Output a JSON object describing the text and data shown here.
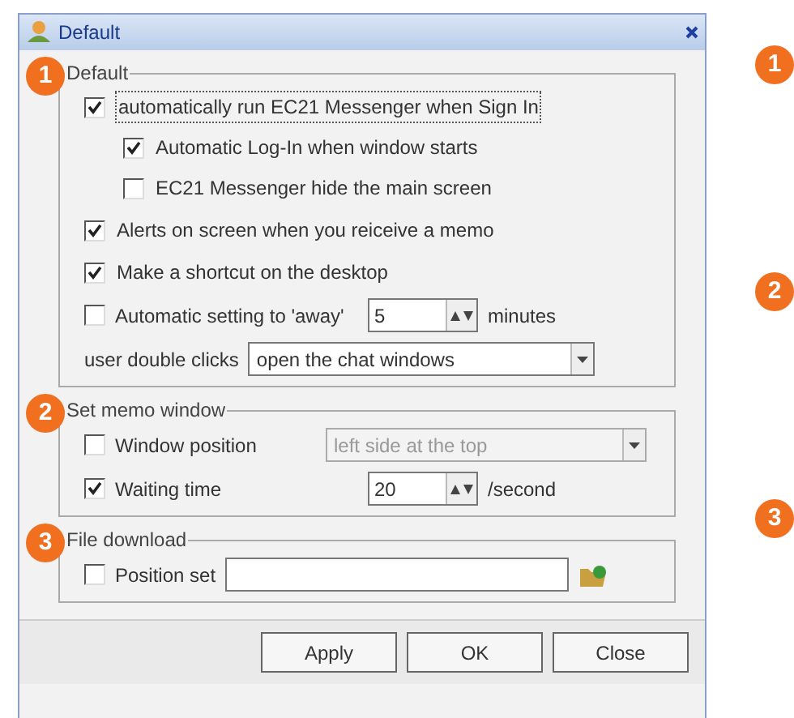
{
  "window": {
    "title": "Default"
  },
  "groups": [
    {
      "badge": "1",
      "title": "Default",
      "items": [
        {
          "kind": "checkbox",
          "label": "automatically run EC21 Messenger when Sign In",
          "checked": true,
          "focused": true,
          "children": [
            {
              "kind": "checkbox",
              "label": "Automatic Log-In when window starts",
              "checked": true,
              "focused": false
            },
            {
              "kind": "checkbox",
              "label": "EC21 Messenger hide the main screen",
              "checked": false,
              "focused": false
            }
          ]
        },
        {
          "kind": "checkbox",
          "label": "Alerts on screen when you reiceive a memo",
          "checked": true,
          "focused": false
        },
        {
          "kind": "checkbox",
          "label": "Make a shortcut on the desktop",
          "checked": true,
          "focused": false
        },
        {
          "kind": "spin",
          "label": "Automatic setting to 'away'",
          "checked": false,
          "value": "5",
          "unit": "minutes"
        },
        {
          "kind": "select",
          "label": "user double clicks",
          "value": "open the chat windows",
          "disabled": false
        }
      ]
    },
    {
      "badge": "2",
      "title": "Set memo window",
      "items": [
        {
          "kind": "check_select",
          "label": "Window position",
          "checked": false,
          "value": "left side at the top",
          "disabled": true
        },
        {
          "kind": "spin",
          "label": "Waiting time",
          "checked": true,
          "value": "20",
          "unit": "/second"
        }
      ]
    },
    {
      "badge": "3",
      "title": "File download",
      "items": [
        {
          "kind": "path",
          "label": "Position set",
          "checked": false
        }
      ]
    }
  ],
  "buttons": [
    "Apply",
    "OK",
    "Close"
  ],
  "side_badges": [
    "1",
    "2",
    "3"
  ]
}
